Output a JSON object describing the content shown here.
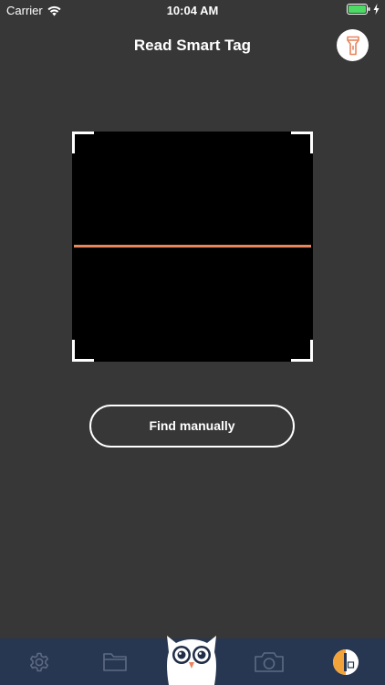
{
  "status_bar": {
    "carrier": "Carrier",
    "time": "10:04 AM",
    "battery_color": "#4cd964"
  },
  "header": {
    "title": "Read Smart Tag"
  },
  "scanner": {
    "scan_line_color": "#e8855c"
  },
  "actions": {
    "find_manually_label": "Find manually"
  },
  "tab_bar": {
    "background": "#273751",
    "items": [
      {
        "icon": "gear-icon"
      },
      {
        "icon": "folder-icon"
      },
      {
        "icon": "owl-logo"
      },
      {
        "icon": "camera-icon"
      },
      {
        "icon": "smart-tag-icon"
      }
    ]
  },
  "colors": {
    "background": "#373737",
    "accent": "#e8855c"
  }
}
